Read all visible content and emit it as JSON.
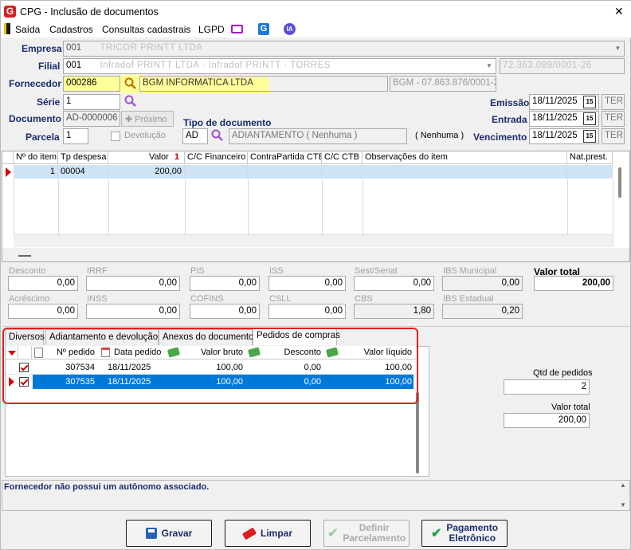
{
  "window": {
    "title": "CPG - Inclusão de documentos",
    "close": "✕"
  },
  "menu": {
    "items": [
      "Saída",
      "Cadastros",
      "Consultas cadastrais",
      "LGPD"
    ],
    "ia_label": "IA"
  },
  "header": {
    "empresa_label": "Empresa",
    "empresa_code": "001",
    "empresa_name": "TRICOR PRINTT LTDA",
    "filial_label": "Filial",
    "filial_code": "001",
    "filial_name": "Infradof PRINTT LTDA · Infradof PRINTT · TORRES",
    "filial_doc": "72.363.089/0001-26",
    "fornecedor_label": "Fornecedor",
    "fornecedor_code": "000286",
    "fornecedor_name": "BGM INFORMATICA LTDA",
    "fornecedor_doc": "BGM - 07.863.876/0001-22",
    "serie_label": "Série",
    "serie_value": "1",
    "documento_label": "Documento",
    "documento_value": "AD-0000006",
    "proximo_label": "Próximo",
    "tipo_label": "Tipo de documento",
    "tipo_code": "AD",
    "tipo_desc": "ADIANTAMENTO ( Nenhuma )",
    "tipo_extra": "( Nenhuma )",
    "parcela_label": "Parcela",
    "parcela_value": "1",
    "devolucao_label": "Devolução",
    "emissao_label": "Emissão",
    "emissao_value": "18/11/2025",
    "emissao_dow": "TER",
    "entrada_label": "Entrada",
    "entrada_value": "18/11/2025",
    "entrada_dow": "TER",
    "vencimento_label": "Vencimento",
    "vencimento_value": "18/11/2025",
    "vencimento_dow": "TER",
    "cal_icon_text": "15"
  },
  "items_grid": {
    "columns": [
      "Nº do item",
      "Tp despesa",
      "Valor",
      "C/C Financeiro",
      "ContraPartida CTB",
      "C/C CTB",
      "Observações do item",
      "Nat.prest."
    ],
    "sort_indicator": "1",
    "rows": [
      {
        "item": "1",
        "tp": "00004",
        "valor": "200,00"
      }
    ]
  },
  "totals": {
    "desconto": {
      "label": "Desconto",
      "value": "0,00"
    },
    "irrf": {
      "label": "IRRF",
      "value": "0,00"
    },
    "pis": {
      "label": "PIS",
      "value": "0,00"
    },
    "iss": {
      "label": "ISS",
      "value": "0,00"
    },
    "sest": {
      "label": "Sest/Senat",
      "value": "0,00"
    },
    "ibs_mun": {
      "label": "IBS Municipal",
      "value": "0,00"
    },
    "valor_total": {
      "label": "Valor total",
      "value": "200,00"
    },
    "acrescimo": {
      "label": "Acréscimo",
      "value": "0,00"
    },
    "inss": {
      "label": "INSS",
      "value": "0,00"
    },
    "cofins": {
      "label": "COFINS",
      "value": "0,00"
    },
    "csll": {
      "label": "CSLL",
      "value": "0,00"
    },
    "cbs": {
      "label": "CBS",
      "value": "1,80"
    },
    "ibs_est": {
      "label": "IBS Estadual",
      "value": "0,20"
    }
  },
  "tabs": [
    "Diversos",
    "Adiantamento e devolução",
    "Anexos do documento",
    "Pedidos de compras"
  ],
  "orders_grid": {
    "columns": [
      "Nº pedido",
      "Data pedido",
      "Valor bruto",
      "Desconto",
      "Valor líquido"
    ],
    "rows": [
      {
        "pedido": "307534",
        "data": "18/11/2025",
        "bruto": "100,00",
        "desconto": "0,00",
        "liquido": "100,00"
      },
      {
        "pedido": "307535",
        "data": "18/11/2025",
        "bruto": "100,00",
        "desconto": "0,00",
        "liquido": "100,00"
      }
    ]
  },
  "orders_summary": {
    "qtd_label": "Qtd de pedidos",
    "qtd_value": "2",
    "total_label": "Valor total",
    "total_value": "200,00"
  },
  "status": {
    "message": "Fornecedor não possui um autônomo associado."
  },
  "buttons": {
    "gravar": "Gravar",
    "limpar": "Limpar",
    "definir_1": "Definir",
    "definir_2": "Parcelamento",
    "pagamento_1": "Pagamento",
    "pagamento_2": "Eletrônico"
  },
  "colors": {
    "accent": "#0078d7",
    "highlight": "#ffff99",
    "label": "#1a2c6e",
    "annotation": "#e02020"
  }
}
